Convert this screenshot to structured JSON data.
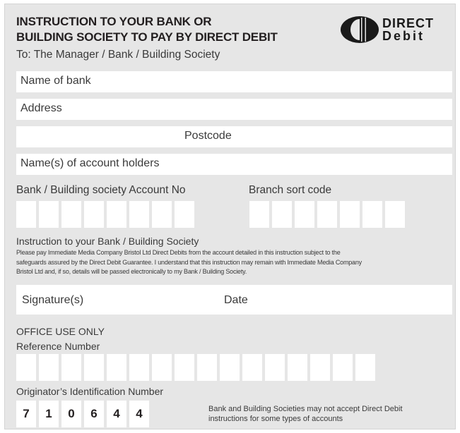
{
  "header": {
    "title_line1": "INSTRUCTION TO YOUR BANK OR",
    "title_line2": "BUILDING SOCIETY TO PAY BY DIRECT DEBIT",
    "to_line": "To: The Manager / Bank / Building Society",
    "logo_word1": "DIRECT",
    "logo_word2": "Debit"
  },
  "fields": {
    "name_of_bank": "Name of bank",
    "address": "Address",
    "postcode": "Postcode",
    "account_holders": "Name(s) of account holders"
  },
  "account": {
    "account_no_label": "Bank / Building society Account No",
    "sort_code_label": "Branch sort code"
  },
  "instruction": {
    "heading": "Instruction to your Bank / Building Society",
    "line1": "Please pay Immediate Media Company Bristol Ltd Direct Debits from the account detailed in this instruction subject to the",
    "line2": "safeguards assured by the Direct Debit Guarantee. I understand that this instruction may remain with Immediate Media Company",
    "line3": "Bristol Ltd and, if so, details will be passed electronically to my Bank / Building Society."
  },
  "signature": {
    "signature_label": "Signature(s)",
    "date_label": "Date"
  },
  "office": {
    "office_use": "OFFICE USE ONLY",
    "reference_label": "Reference Number",
    "originator_label": "Originator’s Identification Number",
    "originator_digits": [
      "7",
      "1",
      "0",
      "6",
      "4",
      "4"
    ]
  },
  "notice": {
    "line1": "Bank and Building Societies may not accept Direct Debit",
    "line2": "instructions for some types of accounts"
  },
  "colors": {
    "form_background": "#e6e6e6",
    "field_background": "#ffffff",
    "text": "#231f20"
  },
  "icons": {
    "logo": "direct-debit-logo-icon"
  }
}
